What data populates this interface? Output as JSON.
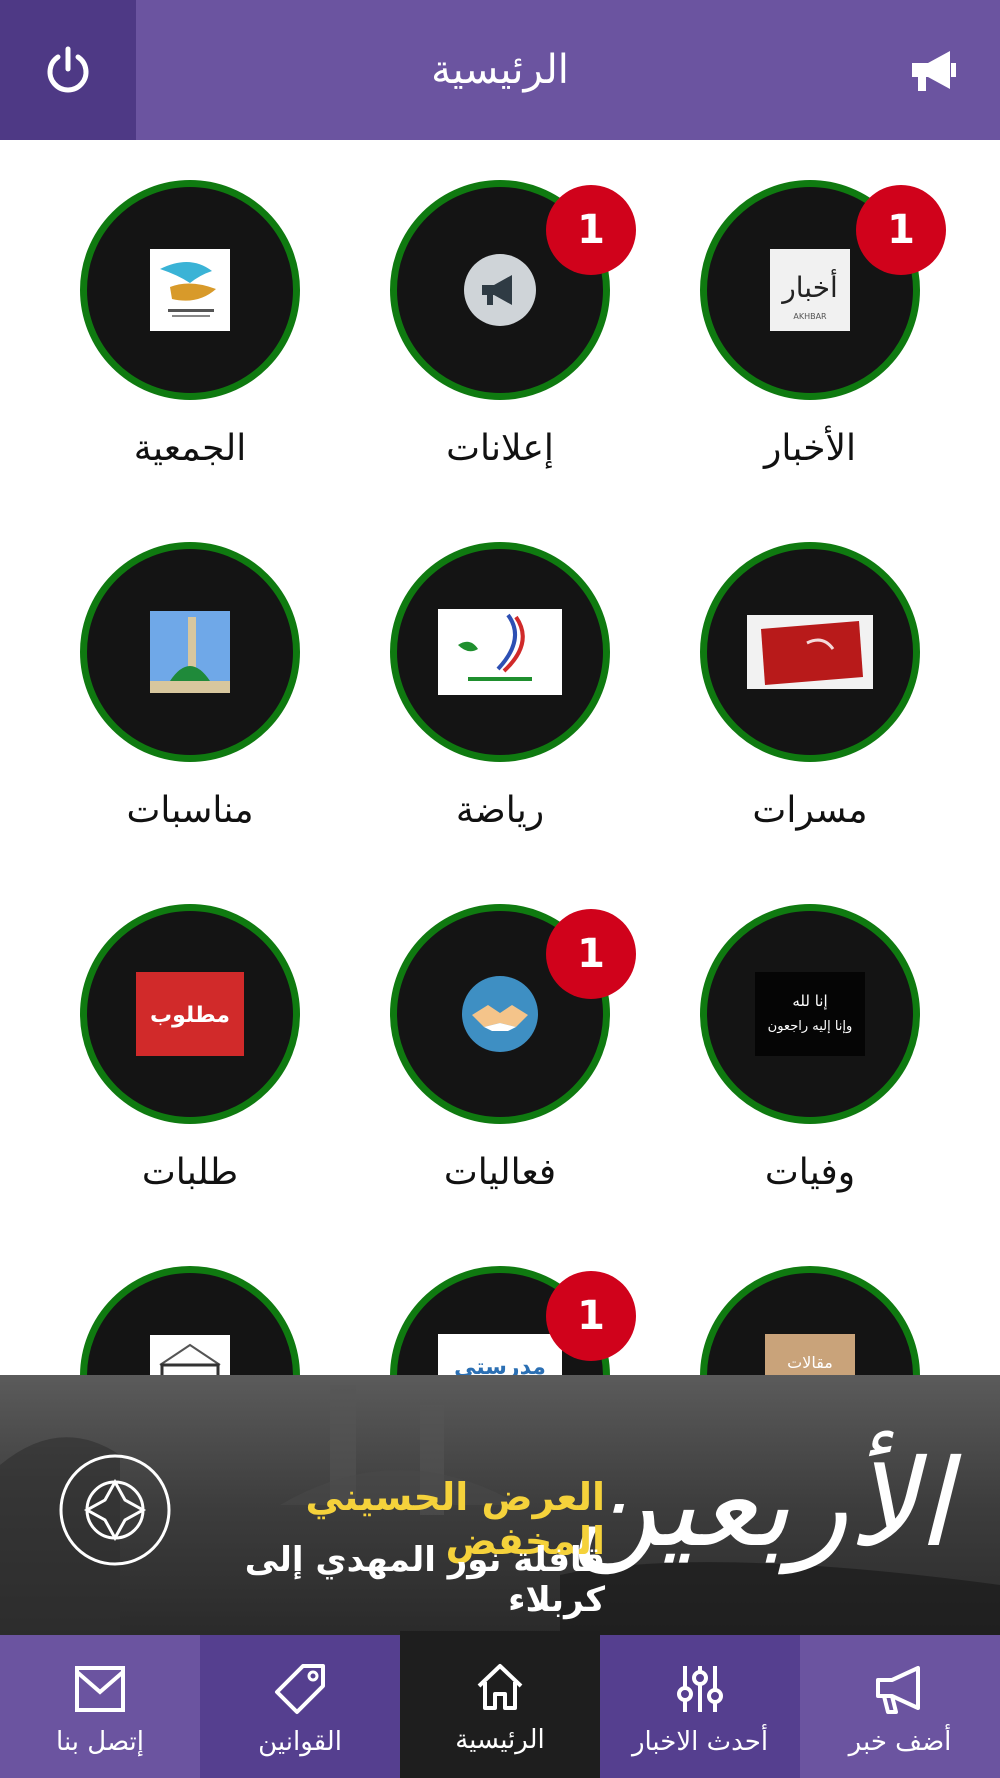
{
  "header": {
    "title": "الرئيسية"
  },
  "tiles": [
    {
      "label": "الأخبار",
      "badge": "1"
    },
    {
      "label": "إعلانات",
      "badge": "1"
    },
    {
      "label": "الجمعية",
      "badge": ""
    },
    {
      "label": "مسرات",
      "badge": ""
    },
    {
      "label": "رياضة",
      "badge": ""
    },
    {
      "label": "مناسبات",
      "badge": ""
    },
    {
      "label": "وفيات",
      "badge": ""
    },
    {
      "label": "فعاليات",
      "badge": "1"
    },
    {
      "label": "طلبات",
      "badge": ""
    },
    {
      "label": "",
      "badge": ""
    },
    {
      "label": "",
      "badge": "1"
    },
    {
      "label": "",
      "badge": ""
    }
  ],
  "thumb_text": {
    "akhbar": "أخبار",
    "akhbar_en": "AKHBAR",
    "matloob": "مطلوب",
    "wafiyat_1": "إنا لله",
    "wafiyat_2": "وإنا إليه راجعون",
    "madrasati": "مدرستي",
    "maqalat": "مقالات"
  },
  "banner": {
    "big": "الأربعين",
    "yellow": "العرض الحسيني المخفض",
    "white": "قافلة نور المهدي إلى كربلاء"
  },
  "bottom_nav": [
    {
      "label": "إتصل بنا",
      "icon": "mail-icon"
    },
    {
      "label": "القوانين",
      "icon": "tag-icon"
    },
    {
      "label": "الرئيسية",
      "icon": "home-icon",
      "active": true
    },
    {
      "label": "أحدث الاخبار",
      "icon": "sliders-icon"
    },
    {
      "label": "أضف خبر",
      "icon": "megaphone-icon"
    }
  ],
  "colors": {
    "header": "#6b54a0",
    "header_dark": "#4e3985",
    "circle_border": "#0f7a10",
    "badge": "#d0021b",
    "nav_active": "#1e1e1e"
  }
}
